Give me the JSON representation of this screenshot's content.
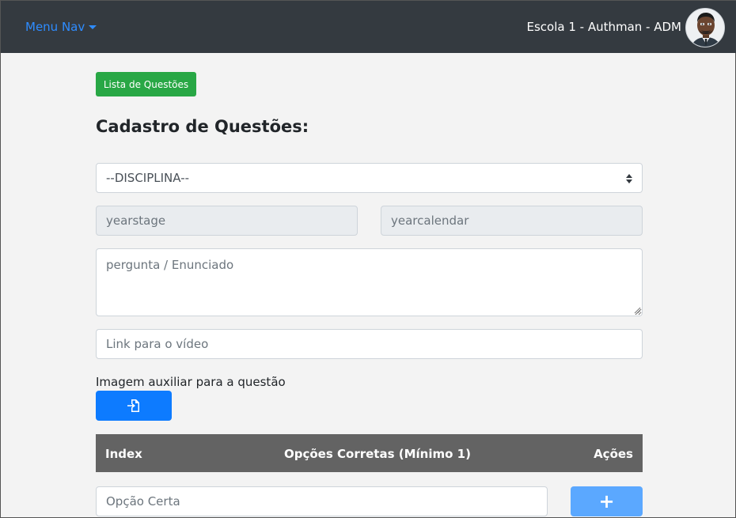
{
  "navbar": {
    "menu_label": "Menu Nav",
    "user_label": "Escola 1 - Authman - ADM"
  },
  "buttons": {
    "question_list": "Lista de Questões",
    "add_option": "+"
  },
  "page": {
    "title": "Cadastro de Questões:"
  },
  "form": {
    "discipline_select": "--DISCIPLINA--",
    "yearstage_placeholder": "yearstage",
    "yearcalendar_placeholder": "yearcalendar",
    "question_placeholder": "pergunta / Enunciado",
    "video_placeholder": "Link para o vídeo",
    "image_label": "Imagem auxiliar para a questão"
  },
  "table": {
    "headers": [
      "Index",
      "Opções Corretas (Mínimo 1)",
      "Ações"
    ],
    "option_placeholder": "Opção Certa"
  },
  "colors": {
    "navbar": "#343a40",
    "link": "#2e8cff",
    "success": "#28a745",
    "primary": "#0d7bff",
    "table_header": "#636363"
  },
  "icons": {
    "file_upload": "file-import-icon",
    "menu_caret": "caret-down-icon",
    "select_arrows": "select-arrows-icon"
  }
}
